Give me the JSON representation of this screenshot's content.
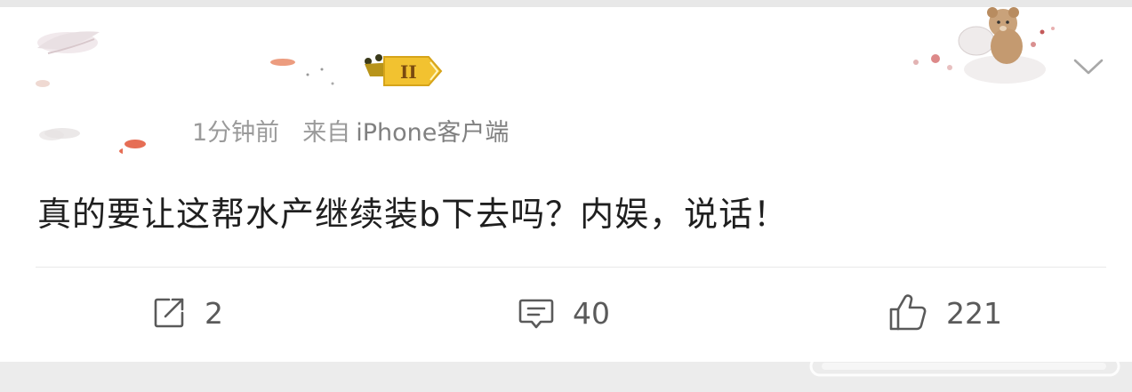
{
  "post": {
    "time": "1分钟前",
    "source_prefix": "来自",
    "client": "iPhone客户端",
    "text": "真的要让这帮水产继续装b下去吗？内娱，说话！"
  },
  "actions": {
    "repost_count": "2",
    "comment_count": "40",
    "like_count": "221"
  },
  "icons": {
    "repost": "share-icon",
    "comment": "comment-icon",
    "like": "thumbs-up-icon",
    "menu": "chevron-down-icon",
    "badge": "gemini-badge-icon"
  },
  "colors": {
    "text": "#1f1f1f",
    "meta": "#8c8c8c",
    "action": "#5a5a5a",
    "badge": "#f2c230"
  }
}
